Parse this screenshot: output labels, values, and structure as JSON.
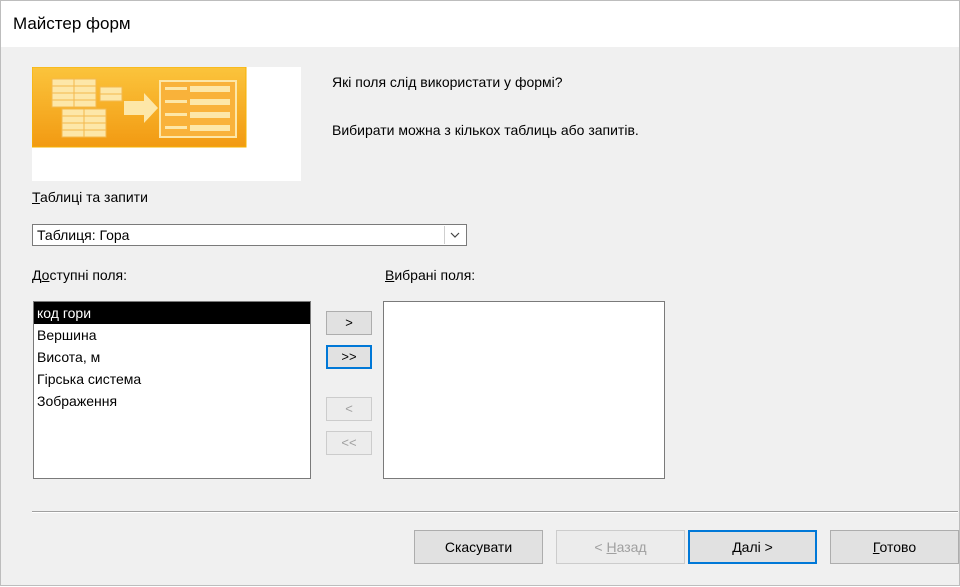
{
  "window": {
    "title": "Майстер форм"
  },
  "header": {
    "question": "Які поля слід використати у формі?",
    "hint": "Вибирати можна з кількох таблиць або запитів."
  },
  "source": {
    "label_underlined": "Т",
    "label_rest": "аблиці та запити",
    "selected": "Таблиця: Гора"
  },
  "available": {
    "label_pre": "Д",
    "label_underlined": "о",
    "label_rest": "ступні поля:",
    "items": [
      "код гори",
      "Вершина",
      "Висота, м",
      "Гірська система",
      "Зображення"
    ]
  },
  "selected_fields": {
    "label_underlined": "В",
    "label_rest": "ибрані поля:",
    "items": []
  },
  "move_buttons": {
    "add_one": ">",
    "add_all": ">>",
    "remove_one": "<",
    "remove_all": "<<"
  },
  "footer": {
    "cancel": "Скасувати",
    "back_pre": "< ",
    "back_underlined": "Н",
    "back_rest": "азад",
    "next_underlined": "Д",
    "next_rest": "алі >",
    "finish_underlined": "Г",
    "finish_rest": "отово"
  },
  "colors": {
    "accent": "#0078d7",
    "illustration_orange": "#f7a823"
  }
}
